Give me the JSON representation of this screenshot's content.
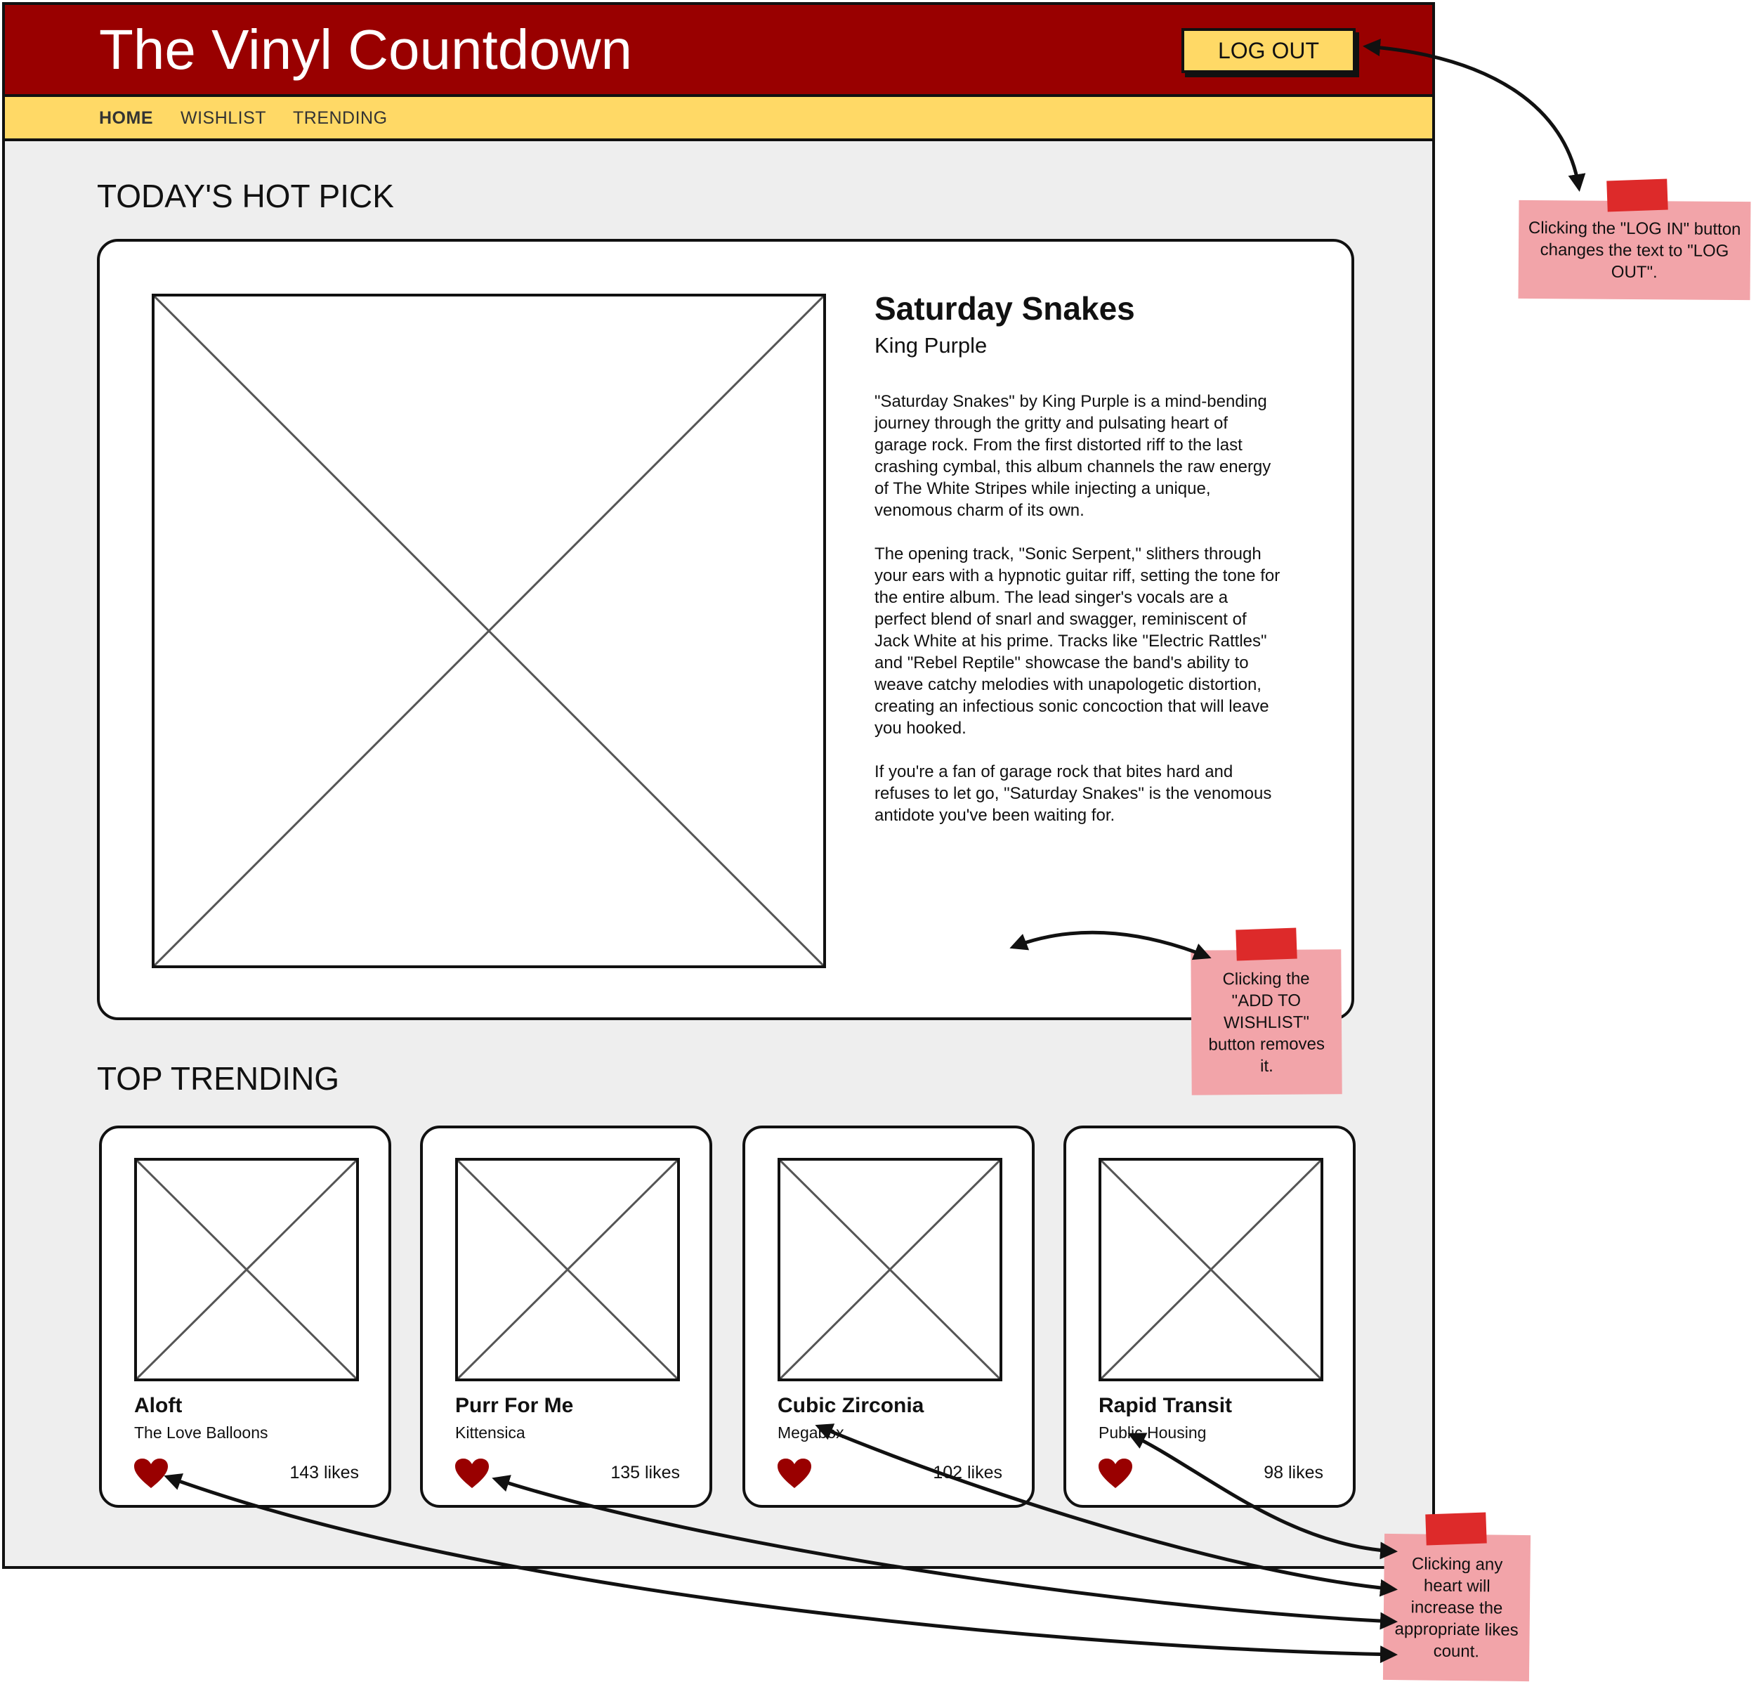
{
  "site": {
    "title": "The Vinyl Countdown",
    "logout_label": "LOG OUT"
  },
  "nav": {
    "items": [
      {
        "label": "HOME",
        "active": true
      },
      {
        "label": "WISHLIST",
        "active": false
      },
      {
        "label": "TRENDING",
        "active": false
      }
    ]
  },
  "hot_pick": {
    "section_title": "TODAY'S HOT PICK",
    "album_title": "Saturday Snakes",
    "artist": "King Purple",
    "description": [
      "\"Saturday Snakes\" by King Purple is a mind-bending journey through the gritty and pulsating heart of garage rock. From the first distorted riff to the last crashing cymbal, this album channels the raw energy of The White Stripes while injecting a unique, venomous charm of its own.",
      "The opening track, \"Sonic Serpent,\" slithers through your ears with a hypnotic guitar riff, setting the tone for the entire album. The lead singer's vocals are a perfect blend of snarl and swagger, reminiscent of Jack White at his prime. Tracks like \"Electric Rattles\" and \"Rebel Reptile\" showcase the band's ability to weave catchy melodies with unapologetic distortion, creating an infectious sonic concoction that will leave you hooked.",
      "If you're a fan of garage rock that bites hard and refuses to let go, \"Saturday Snakes\" is the venomous antidote you've been waiting for."
    ]
  },
  "trending": {
    "section_title": "TOP TRENDING",
    "items": [
      {
        "title": "Aloft",
        "artist": "The Love Balloons",
        "likes": "143 likes"
      },
      {
        "title": "Purr For Me",
        "artist": "Kittensica",
        "likes": "135 likes"
      },
      {
        "title": "Cubic Zirconia",
        "artist": "Megabox",
        "likes": "102 likes"
      },
      {
        "title": "Rapid Transit",
        "artist": "Public Housing",
        "likes": "98 likes"
      }
    ]
  },
  "notes": {
    "login": "Clicking the \"LOG IN\" button changes the text to \"LOG OUT\".",
    "wishlist": "Clicking the \"ADD TO WISHLIST\" button removes it.",
    "hearts": "Clicking any heart will increase the appropriate likes count."
  },
  "colors": {
    "header": "#990000",
    "nav": "#ffd966",
    "heart": "#990000",
    "note": "#f2a4a9",
    "tape": "#dd2a2a"
  }
}
